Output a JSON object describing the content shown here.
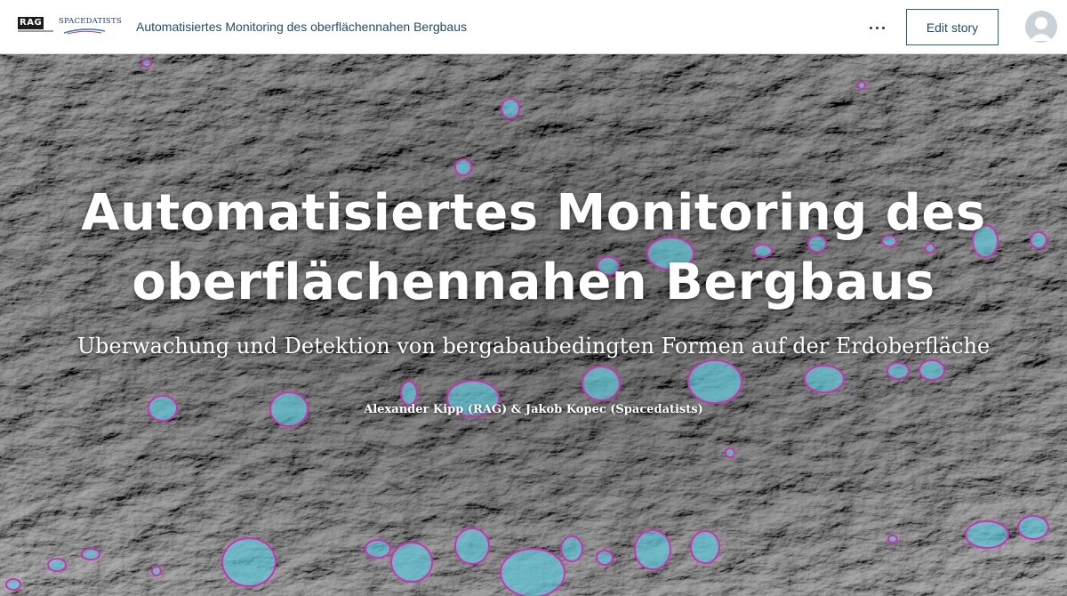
{
  "header": {
    "logos": {
      "rag": "RAG",
      "spacedatists": "SPACEDATISTS"
    },
    "story_title": "Automatisiertes Monitoring des oberflächennahen Bergbaus",
    "more_icon": "ellipsis-icon",
    "edit_button_label": "Edit story",
    "avatar_icon": "user-avatar-icon"
  },
  "hero": {
    "title": "Automatisiertes Monitoring des oberflächennahen Bergbaus",
    "subtitle": "Uberwachung und Detektion von bergabaubedingten Formen auf der Erdoberfläche",
    "byline": "Alexander Kipp (RAG) & Jakob Kopec (Spacedatists)"
  },
  "colors": {
    "header_bg": "#ffffff",
    "title_link": "#1d4e6a",
    "button_border": "#1d6b7a",
    "terrain_dark": "#2b2b2b",
    "terrain_light": "#8a8a8a",
    "detection_fill": "#5fc8d8",
    "detection_outline": "#d22fb4"
  }
}
